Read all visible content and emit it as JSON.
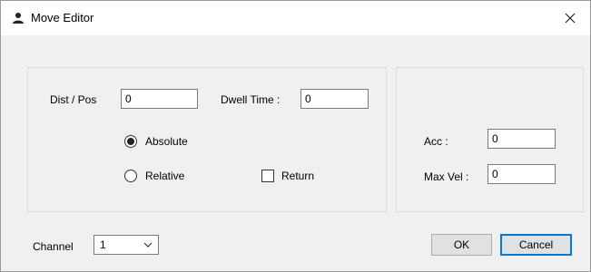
{
  "window": {
    "title": "Move Editor",
    "close_glyph": "✕"
  },
  "main_group": {
    "dist_pos": {
      "label": "Dist / Pos",
      "value": "0"
    },
    "dwell_time": {
      "label": "Dwell Time :",
      "value": "0"
    },
    "mode": {
      "options": [
        {
          "label": "Absolute",
          "selected": true
        },
        {
          "label": "Relative",
          "selected": false
        }
      ]
    },
    "return": {
      "label": "Return",
      "checked": false
    }
  },
  "motion_group": {
    "acc": {
      "label": "Acc :",
      "value": "0"
    },
    "max_vel": {
      "label": "Max Vel :",
      "value": "0"
    }
  },
  "footer": {
    "channel": {
      "label": "Channel",
      "value": "1"
    },
    "ok_label": "OK",
    "cancel_label": "Cancel"
  },
  "icons": {
    "app": "person-icon",
    "close": "close-icon",
    "dropdown": "chevron-down-icon"
  }
}
